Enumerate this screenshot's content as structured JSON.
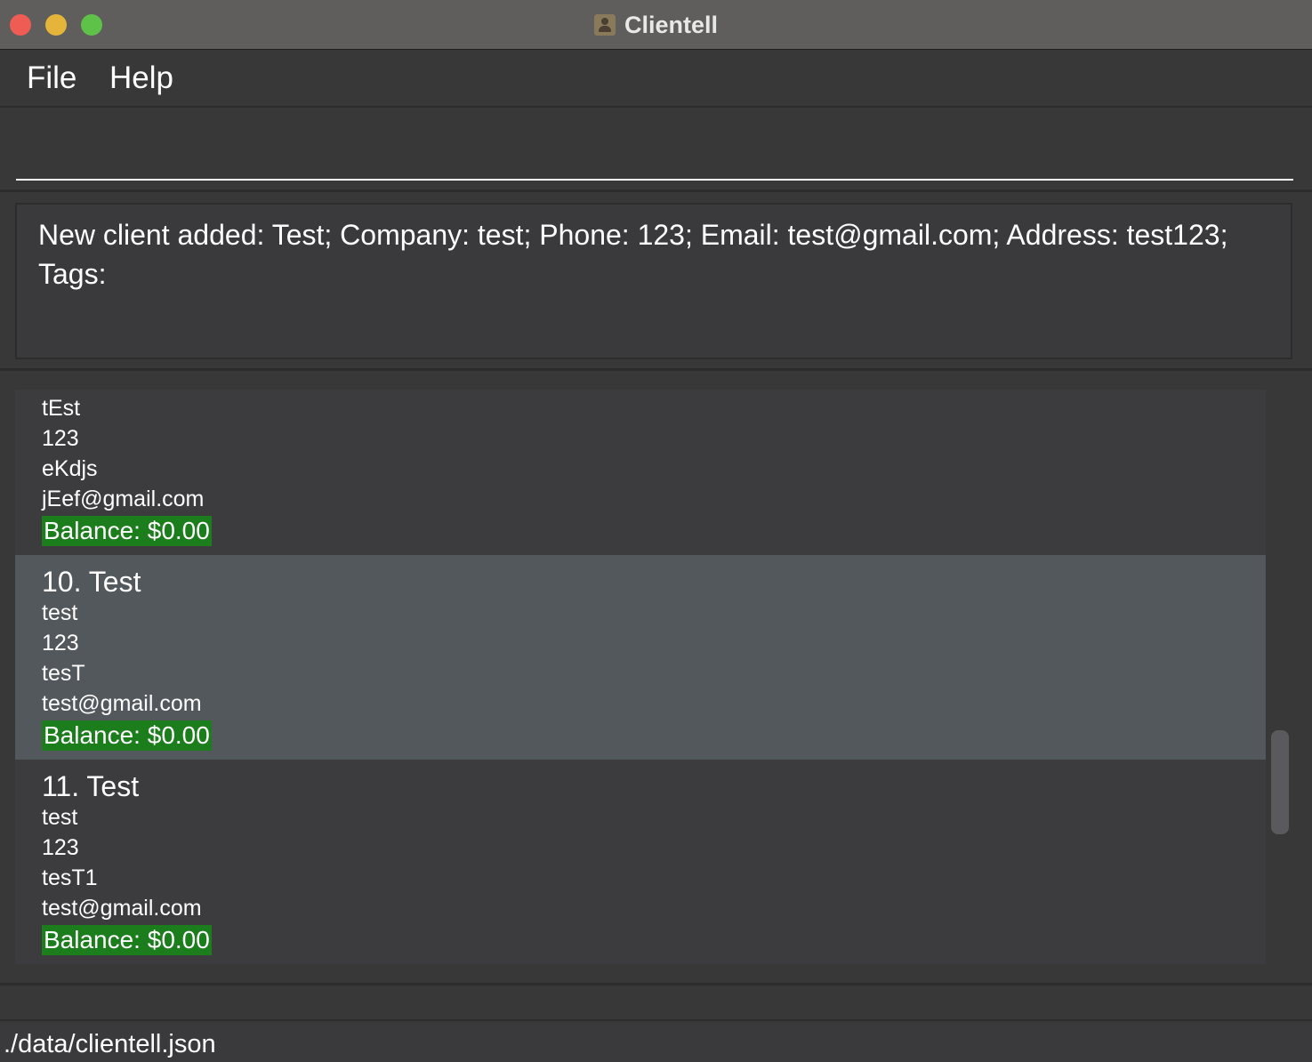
{
  "window": {
    "title": "Clientell"
  },
  "menu": {
    "file": "File",
    "help": "Help"
  },
  "command": {
    "value": "",
    "placeholder": ""
  },
  "result": {
    "message": "New client added: Test; Company: test; Phone: 123; Email: test@gmail.com; Address: test123; Tags:"
  },
  "clients": [
    {
      "name": "",
      "company": "tEst",
      "phone": "123",
      "address": "eKdjs",
      "email": "jEef@gmail.com",
      "balance": "Balance: $0.00",
      "selected": false
    },
    {
      "name": "10. Test",
      "company": "test",
      "phone": "123",
      "address": "tesT",
      "email": "test@gmail.com",
      "balance": "Balance: $0.00",
      "selected": true
    },
    {
      "name": "11. Test",
      "company": "test",
      "phone": "123",
      "address": "tesT1",
      "email": "test@gmail.com",
      "balance": "Balance: $0.00",
      "selected": false
    }
  ],
  "status": {
    "file_path": "./data/clientell.json"
  },
  "colors": {
    "balance_bg": "#1b7d1b",
    "selected_card": "#52585c",
    "card": "#3c3c3e"
  }
}
